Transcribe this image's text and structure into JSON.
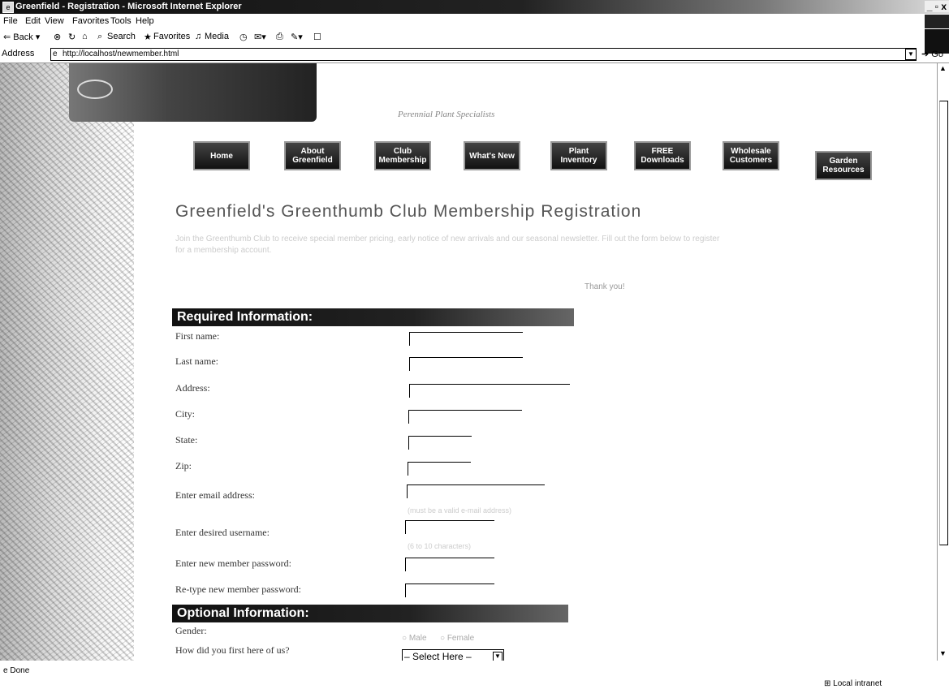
{
  "window": {
    "title": "Greenfield - Registration - Microsoft Internet Explorer",
    "controls": "_ ▫ x"
  },
  "menu": [
    "File",
    "Edit",
    "View",
    "Favorites",
    "Tools",
    "Help"
  ],
  "toolbar": {
    "back": "⇐ Back ▾",
    "search": "Search",
    "favorites": "Favorites",
    "media": "Media"
  },
  "address": {
    "label": "Address",
    "url": "http://localhost/newmember.html",
    "go": "Go"
  },
  "page": {
    "tagline": "Perennial Plant Specialists",
    "nav": [
      "Home",
      "About Greenfield",
      "Club Membership",
      "What's New",
      "Plant Inventory",
      "FREE Downloads",
      "Wholesale Customers",
      "Garden Resources"
    ],
    "title": "Greenfield's Greenthumb Club Membership Registration",
    "intro": "Join the Greenthumb Club to receive special member pricing, early notice of new arrivals and our seasonal newsletter. Fill out the form below to register for a membership account.",
    "intro2": "Thank you!",
    "required_header": "Required Information:",
    "fields": [
      {
        "label": "First name:"
      },
      {
        "label": "Last name:"
      },
      {
        "label": "Address:"
      },
      {
        "label": "City:"
      },
      {
        "label": "State:"
      },
      {
        "label": "Zip:"
      },
      {
        "label": "Enter email address:"
      },
      {
        "label": "Enter desired username:"
      },
      {
        "label": "Enter new member password:"
      },
      {
        "label": "Re-type new member password:"
      }
    ],
    "email_hint": "(must be a valid e-mail address)",
    "username_hint": "(6 to 10 characters)",
    "optional_header": "Optional Information:",
    "gender_label": "Gender:",
    "gender_options": [
      "Male",
      "Female"
    ],
    "referral_label": "How did you first here of us?",
    "referral_select": "– Select Here –"
  },
  "status": {
    "left": "Done",
    "zone": "Local intranet"
  }
}
